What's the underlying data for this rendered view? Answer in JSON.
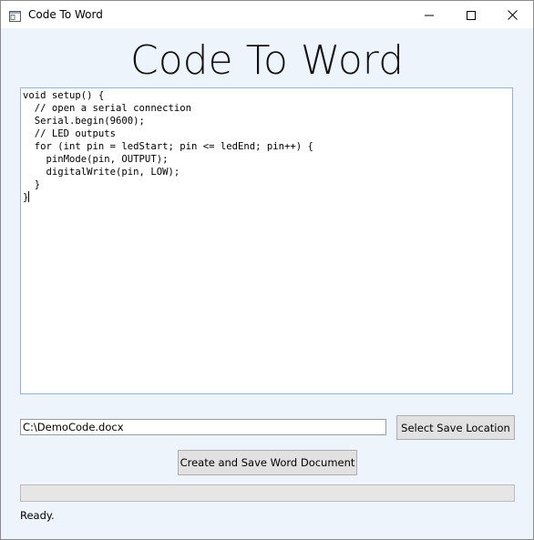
{
  "window": {
    "title": "Code To Word",
    "icons": {
      "app": "app-window-icon",
      "minimize": "minimize-icon",
      "maximize": "maximize-icon",
      "close": "close-icon"
    }
  },
  "main": {
    "heading": "Code To Word",
    "code_lines": [
      "void setup() {",
      "  // open a serial connection",
      "  Serial.begin(9600);",
      "  // LED outputs",
      "  for (int pin = ledStart; pin <= ledEnd; pin++) {",
      "    pinMode(pin, OUTPUT);",
      "    digitalWrite(pin, LOW);",
      "  }",
      "}"
    ],
    "save_path": "C:\\DemoCode.docx",
    "select_location_label": "Select Save Location",
    "create_button_label": "Create and Save Word Document",
    "progress": 0,
    "status": "Ready."
  },
  "colors": {
    "client_background": "#eef4fb",
    "text_border": "#8fb6d6",
    "button_background": "#e1e1e1"
  }
}
